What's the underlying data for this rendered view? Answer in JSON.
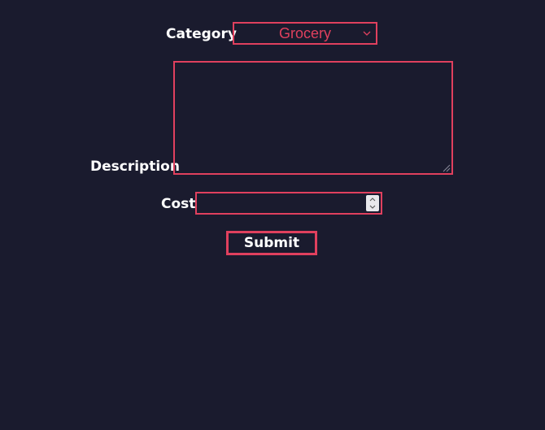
{
  "form": {
    "category_label": "Category",
    "category_value": "Grocery",
    "description_label": "Description",
    "description_value": "",
    "cost_label": "Cost",
    "cost_value": "",
    "submit_label": "Submit"
  },
  "colors": {
    "background": "#1a1b2e",
    "accent": "#e0405e",
    "label_text": "#ffffff"
  },
  "icons": {
    "select_arrow": "chevron-down-icon",
    "textarea_resize": "resize-grip-icon",
    "spin_up": "chevron-up-icon",
    "spin_down": "chevron-down-icon"
  }
}
